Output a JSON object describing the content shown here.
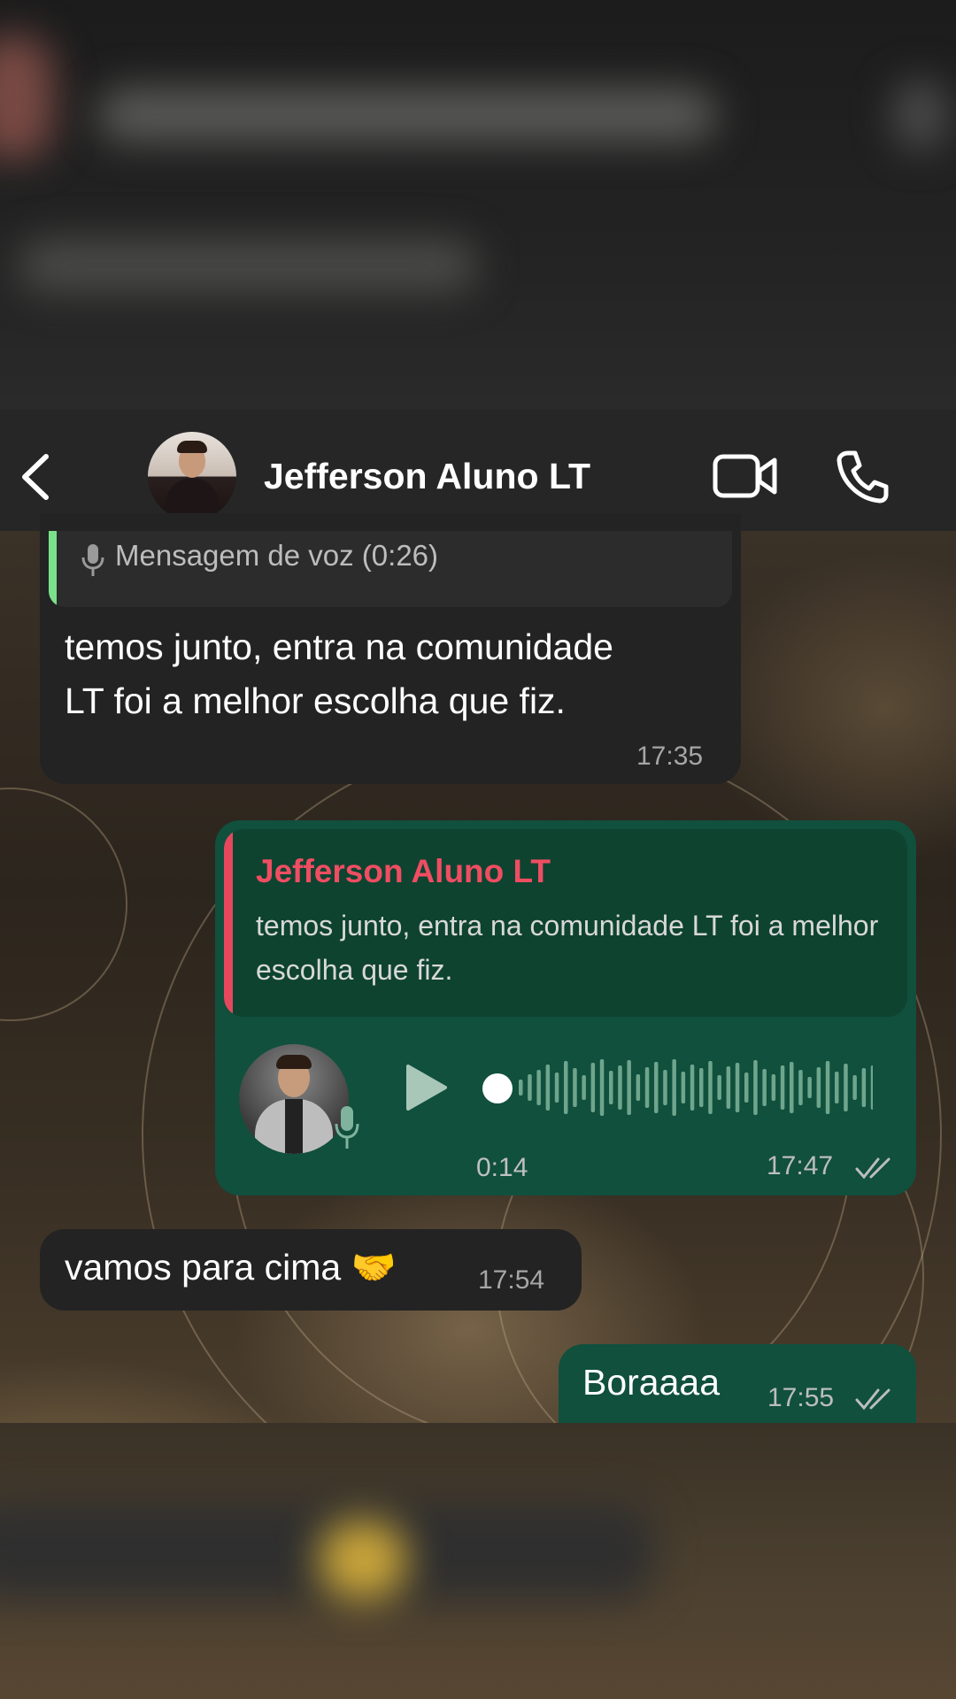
{
  "header": {
    "contact_name": "Jefferson Aluno LT",
    "back_icon": "chevron-left-icon",
    "video_icon": "video-camera-icon",
    "call_icon": "phone-icon"
  },
  "messages": {
    "m1": {
      "quote_label": "Mensagem de voz (0:26)",
      "text_line1": "temos junto,  entra na comunidade",
      "text_line2": "LT foi a melhor escolha que fiz.",
      "time": "17:35"
    },
    "m2": {
      "reply_author": "Jefferson Aluno LT",
      "reply_text": "temos junto,  entra na comunidade LT foi a melhor escolha que fiz.",
      "voice_duration": "0:14",
      "voice_progress": 0,
      "time": "17:47",
      "status": "read"
    },
    "m3": {
      "text": "vamos para cima 🤝",
      "time": "17:54"
    },
    "m4": {
      "text": "Boraaaa",
      "time": "17:55",
      "status": "read"
    }
  },
  "colors": {
    "incoming_bubble": "#232323",
    "outgoing_bubble": "#10503d",
    "quote_bar_green": "#7be08a",
    "reply_bar_red": "#e5485d",
    "reply_author": "#ef4d62"
  }
}
